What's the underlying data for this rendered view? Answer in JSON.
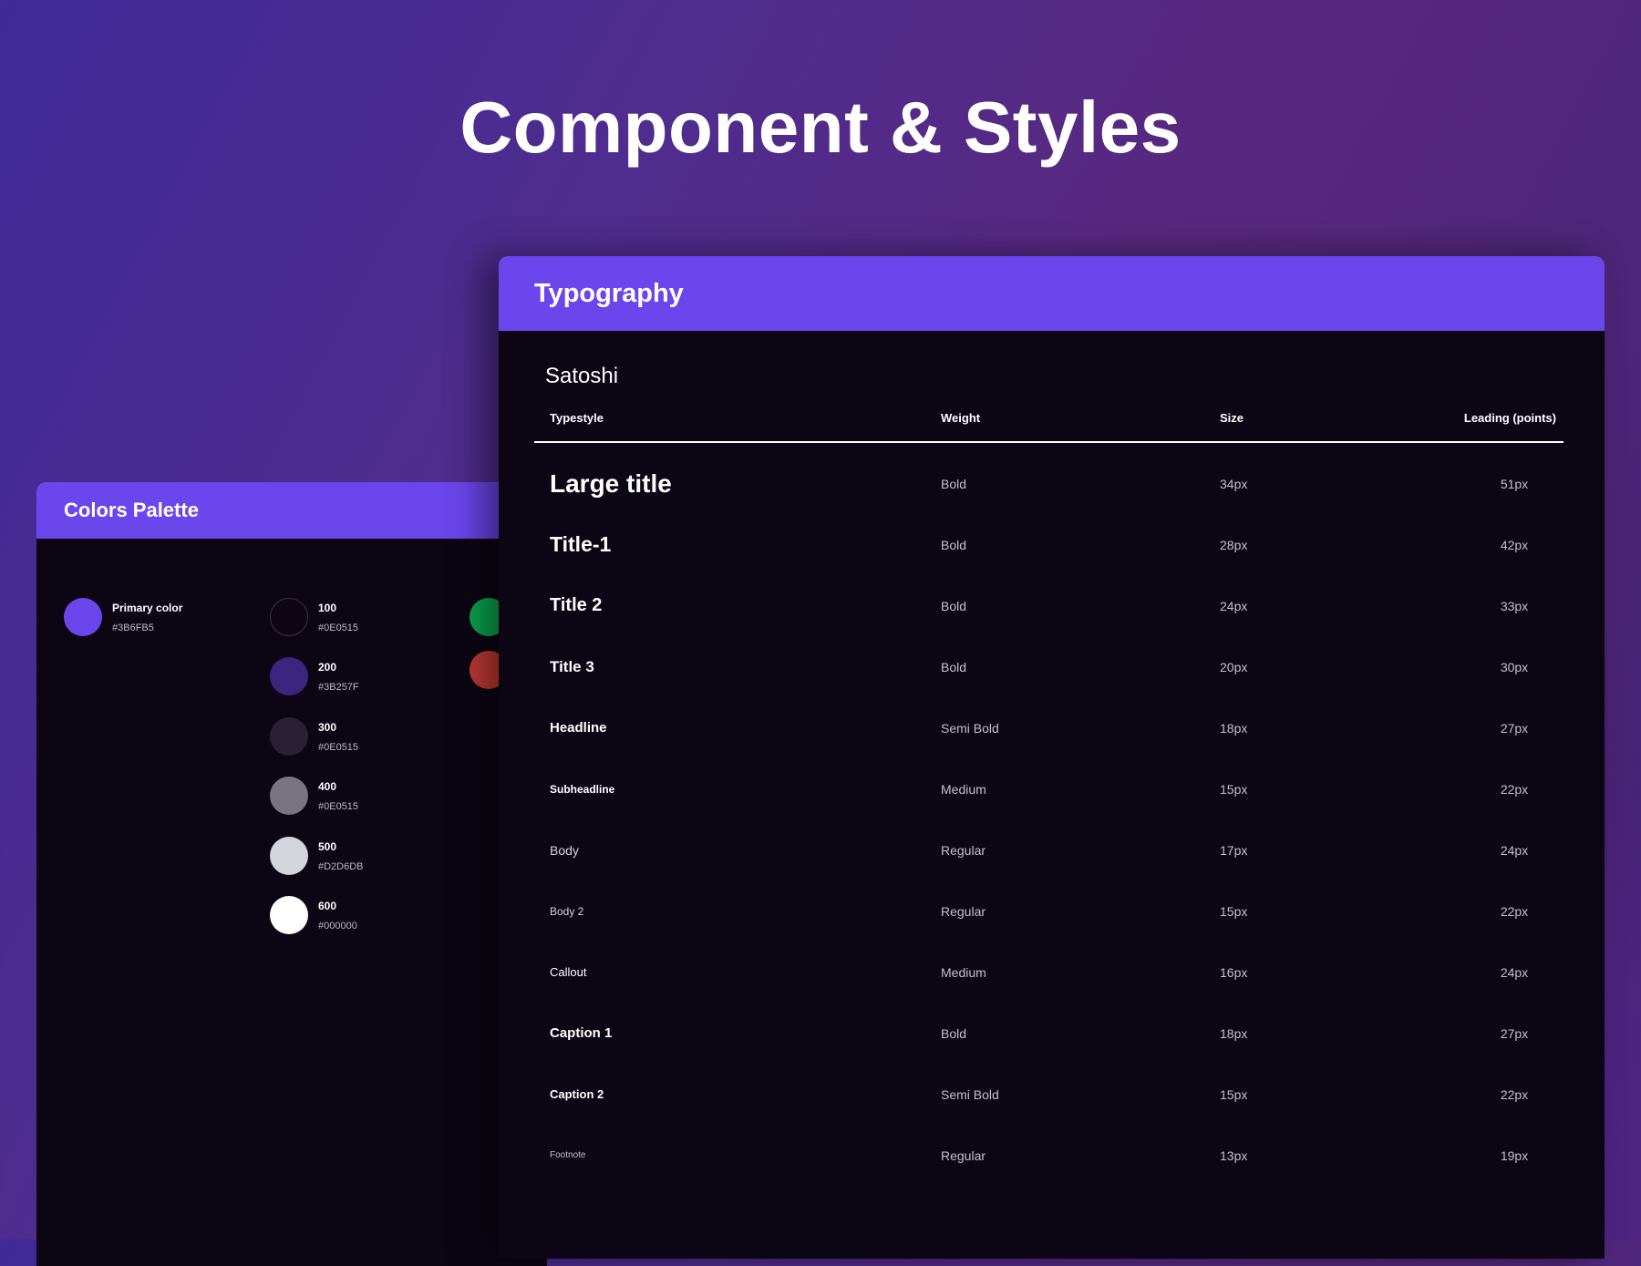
{
  "page": {
    "title": "Component & Styles"
  },
  "palette": {
    "title": "Colors Palette",
    "primary": {
      "name": "Primary color",
      "hex_label": "#3B6FB5",
      "color": "#6b46ec"
    },
    "shades": [
      {
        "name": "100",
        "hex_label": "#0E0515",
        "color": "#0e0515"
      },
      {
        "name": "200",
        "hex_label": "#3B257F",
        "color": "#3b257f"
      },
      {
        "name": "300",
        "hex_label": "#0E0515",
        "color": "#2a2035"
      },
      {
        "name": "400",
        "hex_label": "#0E0515",
        "color": "#7a7482"
      },
      {
        "name": "500",
        "hex_label": "#D2D6DB",
        "color": "#d2d6db"
      },
      {
        "name": "600",
        "hex_label": "#000000",
        "color": "#ffffff"
      }
    ],
    "status_colors": [
      {
        "color": "#0aa84f"
      },
      {
        "color": "#c73a36"
      }
    ]
  },
  "typography": {
    "title": "Typography",
    "font": "Satoshi",
    "columns": {
      "typestyle": "Typestyle",
      "weight": "Weight",
      "size": "Size",
      "leading": "Leading (points)"
    },
    "rows": [
      {
        "style": "Large title",
        "weight": "Bold",
        "size": "34px",
        "leading": "51px"
      },
      {
        "style": "Title-1",
        "weight": "Bold",
        "size": "28px",
        "leading": "42px"
      },
      {
        "style": "Title 2",
        "weight": "Bold",
        "size": "24px",
        "leading": "33px"
      },
      {
        "style": "Title 3",
        "weight": "Bold",
        "size": "20px",
        "leading": "30px"
      },
      {
        "style": "Headline",
        "weight": "Semi Bold",
        "size": "18px",
        "leading": "27px"
      },
      {
        "style": "Subheadline",
        "weight": "Medium",
        "size": "15px",
        "leading": "22px"
      },
      {
        "style": "Body",
        "weight": "Regular",
        "size": "17px",
        "leading": "24px"
      },
      {
        "style": "Body 2",
        "weight": "Regular",
        "size": "15px",
        "leading": "22px"
      },
      {
        "style": "Callout",
        "weight": "Medium",
        "size": "16px",
        "leading": "24px"
      },
      {
        "style": "Caption 1",
        "weight": "Bold",
        "size": "18px",
        "leading": "27px"
      },
      {
        "style": "Caption 2",
        "weight": "Semi Bold",
        "size": "15px",
        "leading": "22px"
      },
      {
        "style": "Footnote",
        "weight": "Regular",
        "size": "13px",
        "leading": "19px"
      }
    ]
  }
}
